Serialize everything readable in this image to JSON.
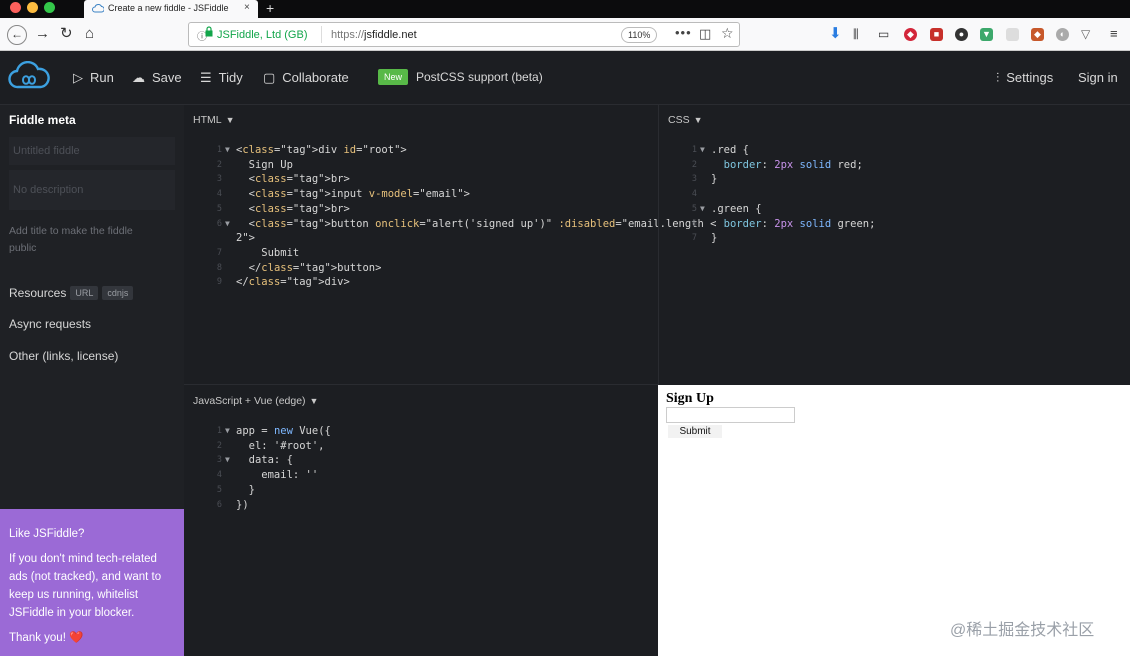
{
  "browser": {
    "tab_title": "Create a new fiddle - JSFiddle",
    "tab_close": "×",
    "new_tab": "+",
    "identity": "JSFiddle, Ltd (GB)",
    "url_protocol": "https://",
    "url_host": "jsfiddle.net",
    "zoom": "110%",
    "page_actions": "•••"
  },
  "header": {
    "run": "Run",
    "save": "Save",
    "tidy": "Tidy",
    "collaborate": "Collaborate",
    "new_badge": "New",
    "postcss": "PostCSS support (beta)",
    "settings": "Settings",
    "sign_in": "Sign in"
  },
  "sidebar": {
    "title": "Fiddle meta",
    "title_placeholder": "Untitled fiddle",
    "desc_placeholder": "No description",
    "help": "Add title to make the fiddle public",
    "resources": "Resources",
    "resources_url": "URL",
    "resources_cdnjs": "cdnjs",
    "async": "Async requests",
    "other": "Other (links, license)"
  },
  "promo": {
    "heading": "Like JSFiddle?",
    "body": "If you don't mind tech-related ads (not tracked), and want to keep us running, whitelist JSFiddle in your blocker.",
    "thanks": "Thank you! ❤️"
  },
  "panels": {
    "html_label": "HTML",
    "css_label": "CSS",
    "js_label": "JavaScript + Vue (edge)",
    "caret": "▼"
  },
  "html_code": [
    {
      "n": "1",
      "text": "<div id=\"root\">",
      "fold": true
    },
    {
      "n": "2",
      "text": "  Sign Up",
      "fold": false
    },
    {
      "n": "3",
      "text": "  <br>",
      "fold": false
    },
    {
      "n": "4",
      "text": "  <input v-model=\"email\">",
      "fold": false
    },
    {
      "n": "5",
      "text": "  <br>",
      "fold": false
    },
    {
      "n": "6",
      "text": "  <button onclick=\"alert('signed up')\" :disabled=\"email.length <",
      "fold": true
    },
    {
      "n": "",
      "text": "2\">",
      "fold": false
    },
    {
      "n": "7",
      "text": "    Submit",
      "fold": false
    },
    {
      "n": "8",
      "text": "  </button>",
      "fold": false
    },
    {
      "n": "9",
      "text": "</div>",
      "fold": false
    }
  ],
  "css_code": [
    {
      "n": "1",
      "text": ".red {",
      "fold": true
    },
    {
      "n": "2",
      "text": "  border: 2px solid red;",
      "fold": false
    },
    {
      "n": "3",
      "text": "}",
      "fold": false
    },
    {
      "n": "4",
      "text": "",
      "fold": false
    },
    {
      "n": "5",
      "text": ".green {",
      "fold": true
    },
    {
      "n": "6",
      "text": "  border: 2px solid green;",
      "fold": false
    },
    {
      "n": "7",
      "text": "}",
      "fold": false
    }
  ],
  "js_code": [
    {
      "n": "1",
      "text": "app = new Vue({",
      "fold": true
    },
    {
      "n": "2",
      "text": "  el: '#root',",
      "fold": false
    },
    {
      "n": "3",
      "text": "  data: {",
      "fold": true
    },
    {
      "n": "4",
      "text": "    email: ''",
      "fold": false
    },
    {
      "n": "5",
      "text": "  }",
      "fold": false
    },
    {
      "n": "6",
      "text": "})",
      "fold": false
    }
  ],
  "result": {
    "heading": "Sign Up",
    "submit": "Submit"
  },
  "watermark": "@稀土掘金技术社区",
  "colors": {
    "accent_new": "#58b948",
    "promo_bg": "#9b6ad6",
    "tag": "#ff6b8b",
    "attr": "#e6c07b"
  }
}
